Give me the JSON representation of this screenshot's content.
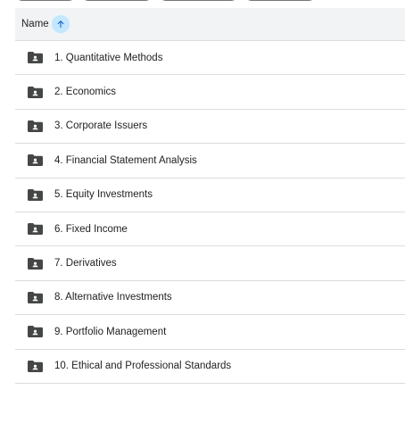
{
  "header": {
    "name_label": "Name",
    "sort_icon": "arrow-up-icon",
    "accent_color": "#c2e7ff"
  },
  "folders": [
    {
      "label": "1. Quantitative Methods",
      "icon": "shared-folder-icon"
    },
    {
      "label": "2. Economics",
      "icon": "shared-folder-icon"
    },
    {
      "label": "3. Corporate Issuers",
      "icon": "shared-folder-icon"
    },
    {
      "label": "4. Financial Statement Analysis",
      "icon": "shared-folder-icon"
    },
    {
      "label": "5. Equity Investments",
      "icon": "shared-folder-icon"
    },
    {
      "label": "6. Fixed Income",
      "icon": "shared-folder-icon"
    },
    {
      "label": "7. Derivatives",
      "icon": "shared-folder-icon"
    },
    {
      "label": "8. Alternative Investments",
      "icon": "shared-folder-icon"
    },
    {
      "label": "9. Portfolio Management",
      "icon": "shared-folder-icon"
    },
    {
      "label": "10. Ethical and Professional Standards",
      "icon": "shared-folder-icon"
    }
  ]
}
